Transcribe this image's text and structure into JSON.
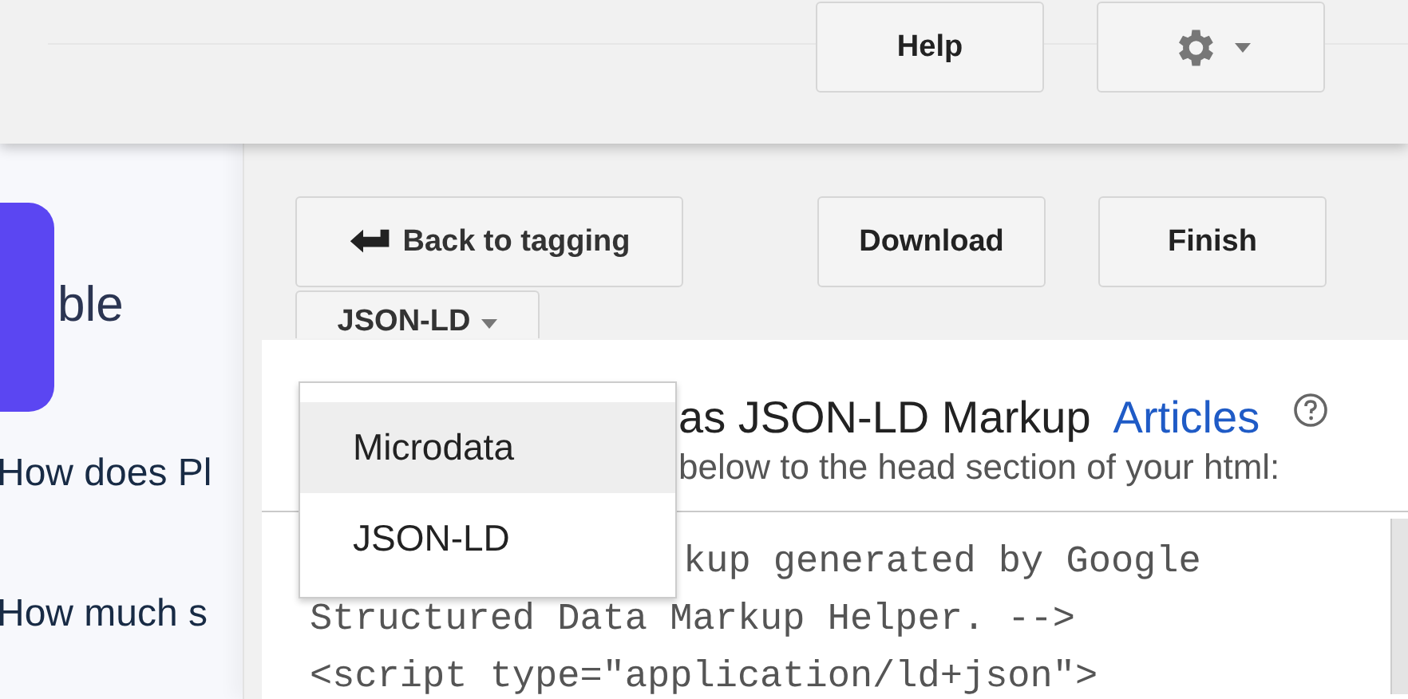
{
  "background_page": {
    "heading_fragment": "ble",
    "questions": [
      "How does Pl",
      "How much s"
    ]
  },
  "header": {
    "buttons": [
      {
        "kind": "text",
        "label": "Help"
      },
      {
        "kind": "settings"
      }
    ]
  },
  "toolbar": {
    "back_button": "Back to tagging",
    "buttons": [
      "Download",
      "Finish"
    ],
    "format_dropdown": "JSON-LD"
  },
  "format_menu": [
    {
      "label": "Microdata",
      "selected": true
    },
    {
      "label": "JSON-LD",
      "selected": false
    }
  ],
  "content": {
    "title": "as JSON-LD Markup",
    "link": "Articles",
    "instruction": "below to the head section of your html:",
    "code_lines": [
      "kup generated by Google",
      "Structured Data Markup Helper. -->",
      "<script type=\"application/ld+json\">"
    ]
  }
}
